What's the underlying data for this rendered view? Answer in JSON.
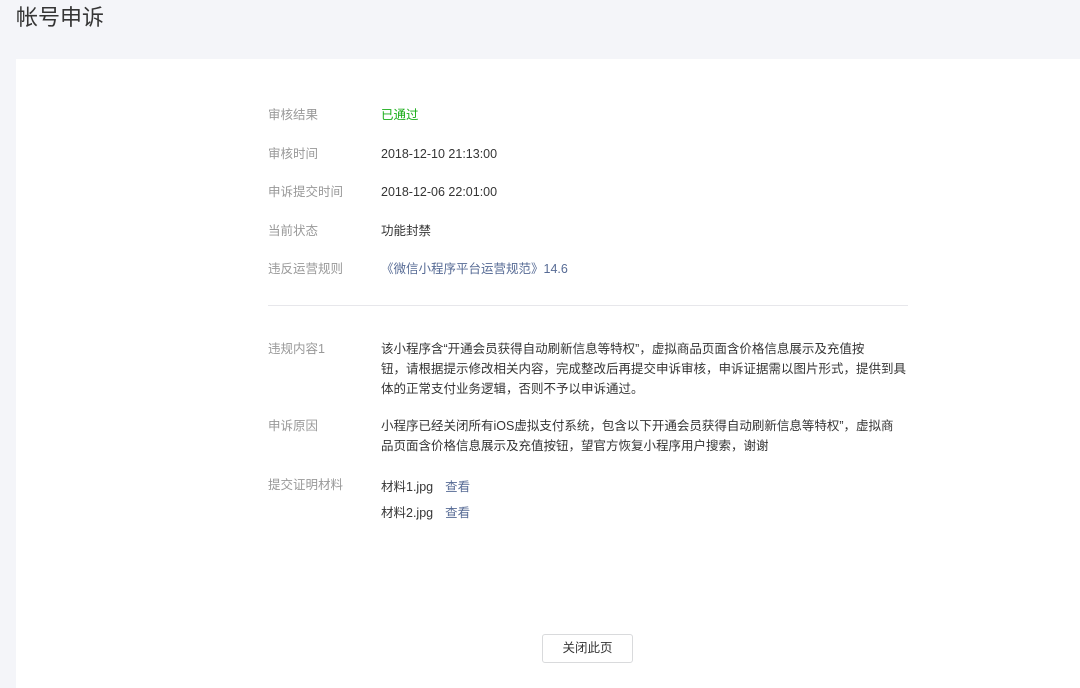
{
  "page": {
    "title": "帐号申诉"
  },
  "colors": {
    "page_background": "#f4f5f9",
    "card_background": "#ffffff",
    "text": "#353535",
    "label": "#999999",
    "success": "#1aad19",
    "link": "#576b95",
    "divider": "#e7e7eb",
    "button_border": "#d9dadc"
  },
  "review_result": {
    "label": "审核结果",
    "value": "已通过"
  },
  "review_time": {
    "label": "审核时间",
    "value": "2018-12-10 21:13:00"
  },
  "submit_time": {
    "label": "申诉提交时间",
    "value": "2018-12-06 22:01:00"
  },
  "current_status": {
    "label": "当前状态",
    "value": "功能封禁"
  },
  "violated_rule": {
    "label": "违反运营规则",
    "link": "《微信小程序平台运营规范》14.6"
  },
  "violation_content": {
    "label": "违规内容1",
    "lines": [
      "该小程序含“开通会员获得自动刷新信息等特权”，虚拟商品页面含价格信息展示及充值按",
      "钮，请根据提示修改相关内容，完成整改后再提交申诉审核，申诉证据需以图片形式，提供到具",
      "体的正常支付业务逻辑，否则不予以申诉通过。"
    ]
  },
  "appeal_reason": {
    "label": "申诉原因",
    "lines": [
      "小程序已经关闭所有iOS虚拟支付系统，包含以下开通会员获得自动刷新信息等特权”，虚拟商",
      "品页面含价格信息展示及充值按钮，望官方恢复小程序用户搜索，谢谢"
    ]
  },
  "evidence": {
    "label": "提交证明材料",
    "files": [
      {
        "name": "材料1.jpg",
        "action": "查看"
      },
      {
        "name": "材料2.jpg",
        "action": "查看"
      }
    ]
  },
  "close_button": {
    "label": "关闭此页"
  }
}
